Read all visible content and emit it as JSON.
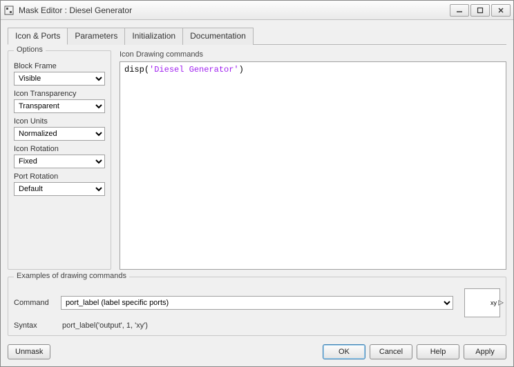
{
  "window": {
    "title": "Mask Editor : Diesel Generator"
  },
  "tabs": [
    {
      "label": "Icon & Ports",
      "active": true
    },
    {
      "label": "Parameters"
    },
    {
      "label": "Initialization"
    },
    {
      "label": "Documentation"
    }
  ],
  "options": {
    "group_title": "Options",
    "block_frame": {
      "label": "Block Frame",
      "value": "Visible"
    },
    "icon_transparency": {
      "label": "Icon Transparency",
      "value": "Transparent"
    },
    "icon_units": {
      "label": "Icon Units",
      "value": "Normalized"
    },
    "icon_rotation": {
      "label": "Icon Rotation",
      "value": "Fixed"
    },
    "port_rotation": {
      "label": "Port Rotation",
      "value": "Default"
    }
  },
  "icon_commands": {
    "title": "Icon Drawing commands",
    "code_fn": "disp",
    "code_paren_open": "(",
    "code_str": "'Diesel Generator'",
    "code_paren_close": ")"
  },
  "examples": {
    "group_title": "Examples of drawing commands",
    "command_label": "Command",
    "command_value": "port_label (label specific ports)",
    "syntax_label": "Syntax",
    "syntax_value": "port_label('output', 1, 'xy')",
    "preview_text": "xy"
  },
  "buttons": {
    "unmask": "Unmask",
    "ok": "OK",
    "cancel": "Cancel",
    "help": "Help",
    "apply": "Apply"
  }
}
